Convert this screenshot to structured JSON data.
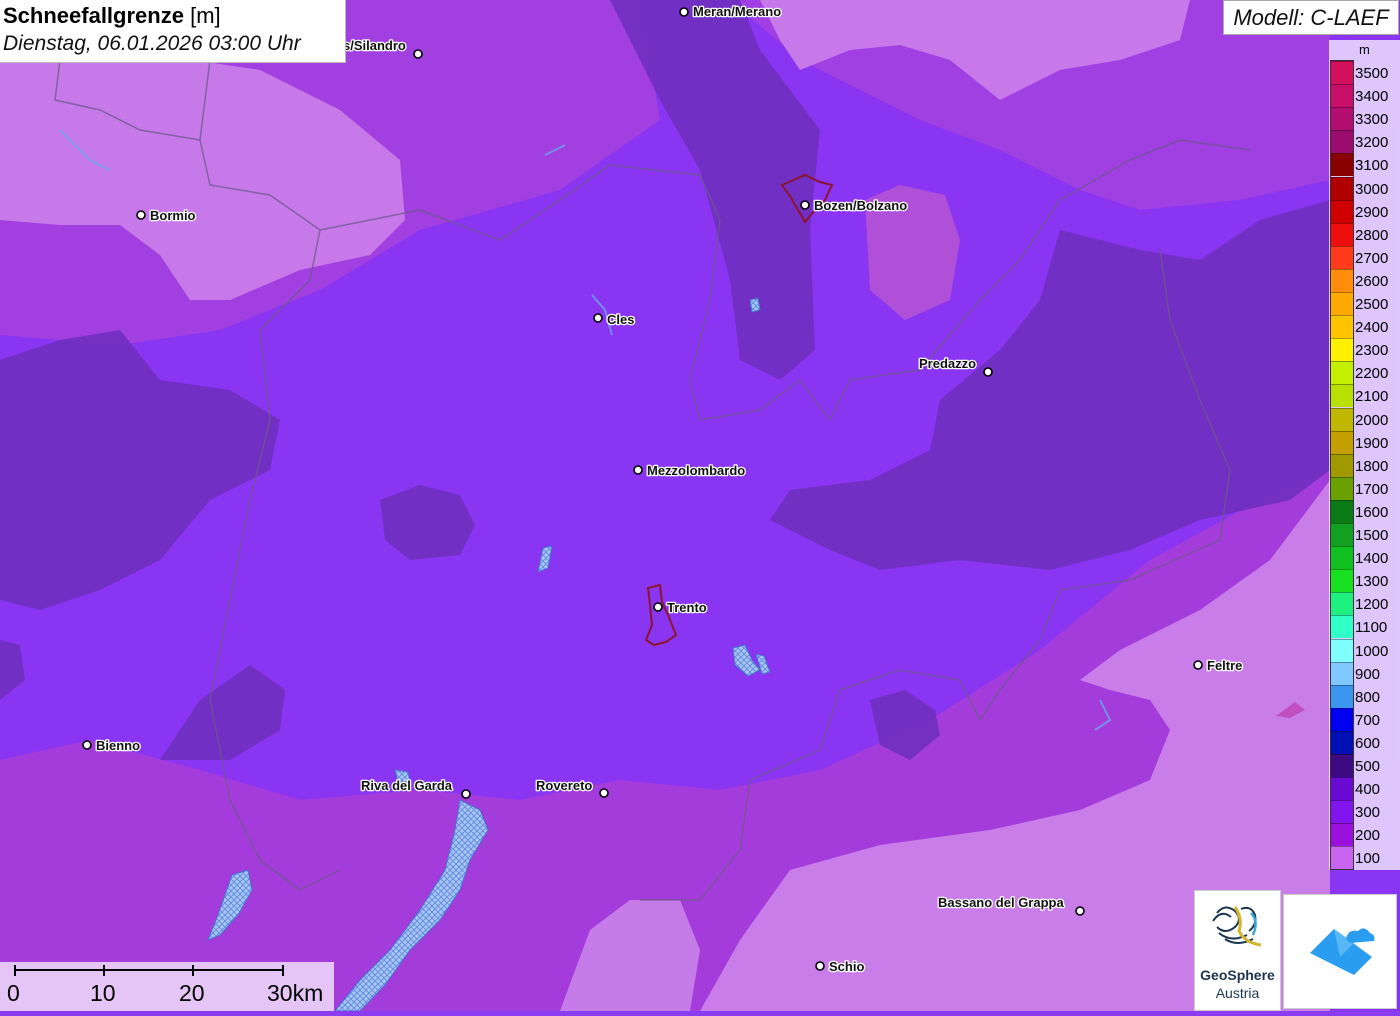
{
  "header": {
    "title": "Schneefallgrenze",
    "unit": "[m]",
    "datetime": "Dienstag, 06.01.2026 03:00 Uhr"
  },
  "model": {
    "label": "Modell: C-LAEF"
  },
  "legend": {
    "unit": "m",
    "entries": [
      {
        "label": "3500",
        "color": "#d4105c"
      },
      {
        "label": "3400",
        "color": "#c80f6a"
      },
      {
        "label": "3300",
        "color": "#b20d70"
      },
      {
        "label": "3200",
        "color": "#9b0c6e"
      },
      {
        "label": "3100",
        "color": "#8a0000"
      },
      {
        "label": "3000",
        "color": "#b00000"
      },
      {
        "label": "2900",
        "color": "#d00000"
      },
      {
        "label": "2800",
        "color": "#ee0e0e"
      },
      {
        "label": "2700",
        "color": "#ff3b1a"
      },
      {
        "label": "2600",
        "color": "#ff8c0a"
      },
      {
        "label": "2500",
        "color": "#ffa800"
      },
      {
        "label": "2400",
        "color": "#ffc400"
      },
      {
        "label": "2300",
        "color": "#fff000"
      },
      {
        "label": "2200",
        "color": "#c4f000"
      },
      {
        "label": "2100",
        "color": "#b8e000"
      },
      {
        "label": "2000",
        "color": "#c0b800"
      },
      {
        "label": "1900",
        "color": "#c4a000"
      },
      {
        "label": "1800",
        "color": "#a09a00"
      },
      {
        "label": "1700",
        "color": "#6aa000"
      },
      {
        "label": "1600",
        "color": "#0a7a14"
      },
      {
        "label": "1500",
        "color": "#12a020"
      },
      {
        "label": "1400",
        "color": "#10c020"
      },
      {
        "label": "1300",
        "color": "#18e020"
      },
      {
        "label": "1200",
        "color": "#20f080"
      },
      {
        "label": "1100",
        "color": "#30ffc8"
      },
      {
        "label": "1000",
        "color": "#80ffff"
      },
      {
        "label": "900",
        "color": "#80c8ff"
      },
      {
        "label": "800",
        "color": "#3c96f0"
      },
      {
        "label": "700",
        "color": "#0000f0"
      },
      {
        "label": "600",
        "color": "#0010b4"
      },
      {
        "label": "500",
        "color": "#3c0a82"
      },
      {
        "label": "400",
        "color": "#6a0ad2"
      },
      {
        "label": "300",
        "color": "#8214f0"
      },
      {
        "label": "200",
        "color": "#9a10dc"
      },
      {
        "label": "100",
        "color": "#c864f0"
      }
    ]
  },
  "cities": [
    {
      "name": "Meran/Merano"
    },
    {
      "name": "s/Silandro"
    },
    {
      "name": "Bozen/Bolzano"
    },
    {
      "name": "Bormio"
    },
    {
      "name": "Cles"
    },
    {
      "name": "Predazzo"
    },
    {
      "name": "Mezzolombardo"
    },
    {
      "name": "Trento"
    },
    {
      "name": "Feltre"
    },
    {
      "name": "Bienno"
    },
    {
      "name": "Riva del Garda"
    },
    {
      "name": "Rovereto"
    },
    {
      "name": "Bassano del Grappa"
    },
    {
      "name": "Schio"
    }
  ],
  "scale": {
    "labels": [
      "0",
      "10",
      "20",
      "30km"
    ]
  },
  "logos": {
    "geosphere_line1": "GeoSphere",
    "geosphere_line2": "Austria"
  }
}
